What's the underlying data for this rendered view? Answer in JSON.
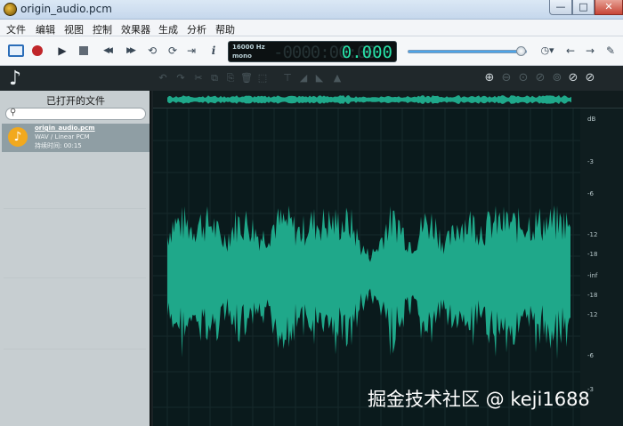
{
  "window": {
    "title": "origin_audio.pcm",
    "minimize": "—",
    "maximize": "□",
    "close": "✕"
  },
  "menu": [
    "文件",
    "编辑",
    "视图",
    "控制",
    "效果器",
    "生成",
    "分析",
    "帮助"
  ],
  "toolbar": {
    "info": "i",
    "lcd": {
      "rate": "16000 Hz",
      "channels": "mono",
      "ghost": "-0000:00:00",
      "time": "0.000"
    },
    "volume": 0.95
  },
  "icons": {
    "play": "▶",
    "rew": "◀◀",
    "ffw": "▶▶",
    "loop": "⟲",
    "loop2": "⟳",
    "skip": "⇥",
    "history": "◷▾",
    "back": "←",
    "fwd": "→",
    "mute": "🔇",
    "note": "♪",
    "zoom": [
      "⊕",
      "⊖",
      "⊙",
      "⊘",
      "⊚"
    ],
    "dark_tools": [
      "↶",
      "↷",
      "✂",
      "⧉",
      "⎘",
      "🗑",
      "⬚",
      "⊤",
      "◢",
      "◣",
      "▲",
      "⌂"
    ]
  },
  "left_panel": {
    "title": "已打开的文件",
    "search_placeholder": "",
    "file": {
      "name": "origin_audio.pcm",
      "format": "WAV / Linear PCM",
      "duration": "持续时间: 00:15"
    }
  },
  "db_scale": [
    "dB",
    "-3",
    "-6",
    "-12",
    "-18",
    "-inf",
    "-18",
    "-12",
    "-6",
    "-3"
  ],
  "watermark": "掘金技术社区 @ keji1688",
  "colors": {
    "wave": "#1fa88a",
    "lcd_time": "#27e0a7",
    "record": "#c0262a"
  }
}
